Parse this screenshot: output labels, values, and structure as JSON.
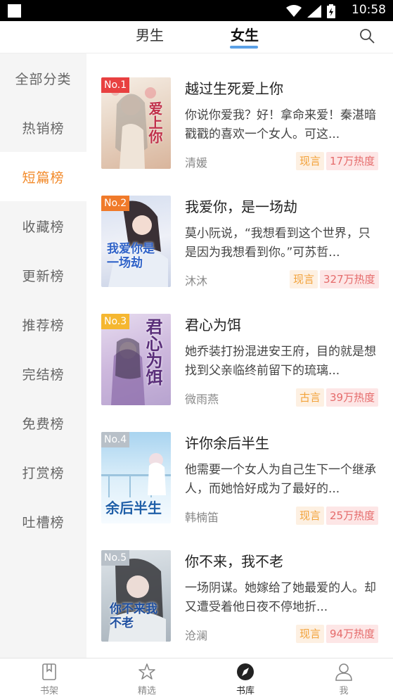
{
  "status": {
    "time": "10:58"
  },
  "tabs": {
    "male": "男生",
    "female": "女生"
  },
  "sidebar": [
    {
      "label": "全部分类"
    },
    {
      "label": "热销榜"
    },
    {
      "label": "短篇榜",
      "active": true
    },
    {
      "label": "收藏榜"
    },
    {
      "label": "更新榜"
    },
    {
      "label": "推荐榜"
    },
    {
      "label": "完结榜"
    },
    {
      "label": "免费榜"
    },
    {
      "label": "打赏榜"
    },
    {
      "label": "吐槽榜"
    }
  ],
  "books": [
    {
      "rank": "No.1",
      "title": "越过生死爱上你",
      "desc": "你说你爱我？好！拿命来爱！秦湛暗戳戳的喜欢一个女人。可这...",
      "author": "清媛",
      "genre": "现言",
      "heat": "17万热度",
      "cover_text": "爱上你",
      "rank_color": "#e84040"
    },
    {
      "rank": "No.2",
      "title": "我爱你，是一场劫",
      "desc": "莫小阮说，“我想看到这个世界，只是因为我想看到你。”可苏哲...",
      "author": "沐沐",
      "genre": "现言",
      "heat": "327万热度",
      "cover_text": "我爱你是一场劫",
      "rank_color": "#f07a2a"
    },
    {
      "rank": "No.3",
      "title": "君心为饵",
      "desc": "她乔装打扮混进安王府，目的就是想找到父亲临终前留下的琉璃...",
      "author": "微雨燕",
      "genre": "古言",
      "heat": "39万热度",
      "cover_text": "君心为饵",
      "rank_color": "#f5b731"
    },
    {
      "rank": "No.4",
      "title": "许你余后半生",
      "desc": "他需要一个女人为自己生下一个继承人，而她恰好成为了最好的...",
      "author": "韩楠笛",
      "genre": "现言",
      "heat": "25万热度",
      "cover_text": "余后半生",
      "rank_color": "#b8c0c8"
    },
    {
      "rank": "No.5",
      "title": "你不来，我不老",
      "desc": "一场阴谋。她嫁给了她最爱的人。却又遭受着他日夜不停地折...",
      "author": "沧澜",
      "genre": "现言",
      "heat": "94万热度",
      "cover_text": "你不来我不老",
      "rank_color": "#b8c0c8"
    }
  ],
  "bottom_nav": [
    {
      "label": "书架",
      "icon": "bookshelf-icon"
    },
    {
      "label": "精选",
      "icon": "star-icon"
    },
    {
      "label": "书库",
      "icon": "compass-icon",
      "active": true
    },
    {
      "label": "我",
      "icon": "user-icon"
    }
  ]
}
